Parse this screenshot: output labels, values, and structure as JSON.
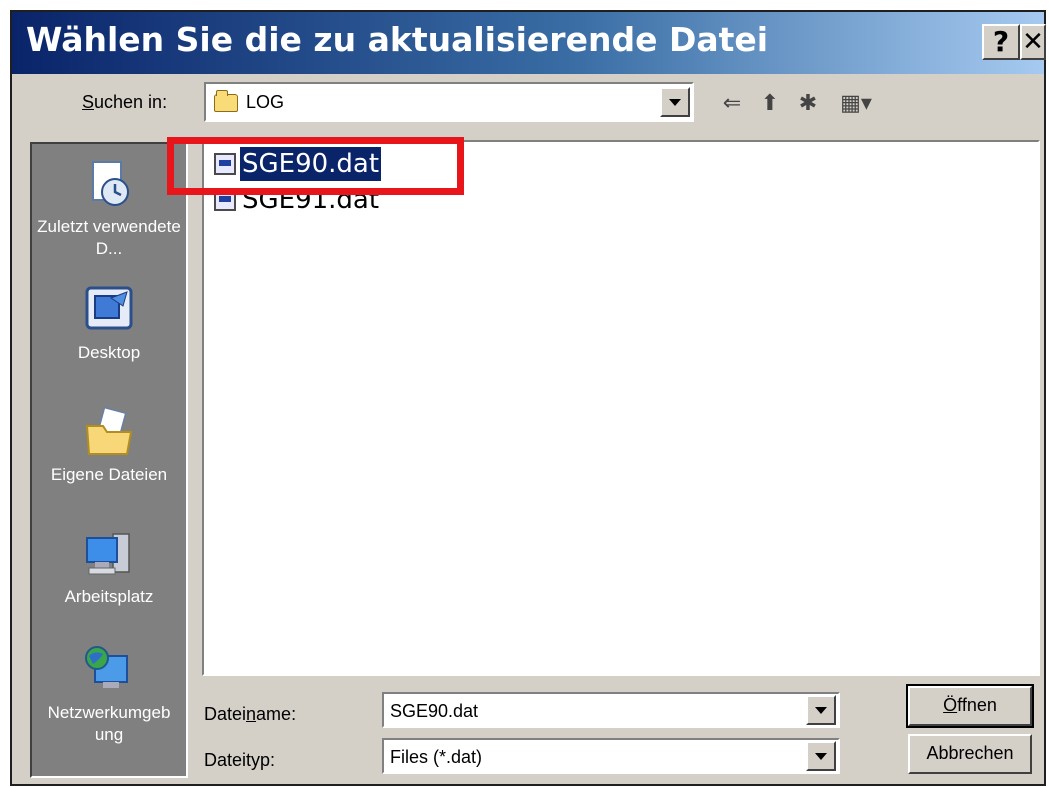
{
  "window": {
    "title": "Wählen Sie die zu aktualisierende Datei",
    "help_label": "?",
    "close_label": "✕"
  },
  "lookin": {
    "label_underlined": "S",
    "label_rest": "uchen in:",
    "value": "LOG"
  },
  "toolbar": {
    "back_glyph": "⇐",
    "up_glyph": "⬆",
    "newfolder_glyph": "✱",
    "view_glyph": "▦▾"
  },
  "places": [
    {
      "label": "Zuletzt verwendete D...",
      "icon": "recent-documents-icon"
    },
    {
      "label": "Desktop",
      "icon": "desktop-icon"
    },
    {
      "label": "Eigene Dateien",
      "icon": "my-documents-icon"
    },
    {
      "label": "Arbeitsplatz",
      "icon": "my-computer-icon"
    },
    {
      "label": "Netzwerkumgeb ung",
      "icon": "network-places-icon"
    }
  ],
  "files": [
    {
      "name": "SGE90.dat",
      "selected": true
    },
    {
      "name": "SGE91.dat",
      "selected": false
    }
  ],
  "filename": {
    "label_a": "Datei",
    "label_u": "n",
    "label_b": "ame:",
    "value": "SGE90.dat"
  },
  "filetype": {
    "label": "Dateityp:",
    "value": "Files (*.dat)"
  },
  "buttons": {
    "open_u": "Ö",
    "open_rest": "ffnen",
    "cancel": "Abbrechen"
  },
  "colors": {
    "selection": "#0a246a",
    "highlight_box": "#e8161a",
    "dialog_face": "#d4d0c8"
  }
}
